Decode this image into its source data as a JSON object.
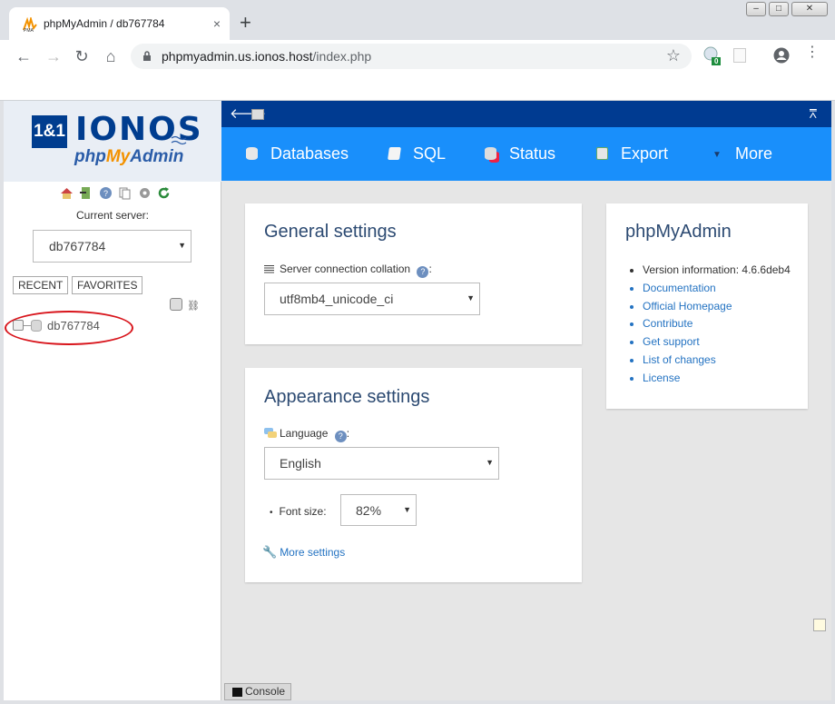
{
  "browser": {
    "tab_title": "phpMyAdmin / db767784",
    "tab_close": "×",
    "new_tab": "+",
    "url_host": "phpmyadmin.us.ionos.host",
    "url_path": "/index.php",
    "extension_badge": "0"
  },
  "sidebar": {
    "logo_11": "1&1",
    "logo_ionos": "IONOS",
    "logo_php": "php",
    "logo_my": "My",
    "logo_admin": "Admin",
    "current_server_label": "Current server:",
    "server_value": "db767784",
    "recent_label": "RECENT",
    "favorites_label": "FAVORITES",
    "tree_db": "db767784"
  },
  "tabs": [
    {
      "label": "Databases",
      "icon": "database-icon"
    },
    {
      "label": "SQL",
      "icon": "sql-icon"
    },
    {
      "label": "Status",
      "icon": "status-icon"
    },
    {
      "label": "Export",
      "icon": "export-icon"
    },
    {
      "label": "More",
      "icon": "chevron-down-icon"
    }
  ],
  "general": {
    "title": "General settings",
    "collation_label": "Server connection collation",
    "collation_value": "utf8mb4_unicode_ci"
  },
  "appearance": {
    "title": "Appearance settings",
    "language_label": "Language",
    "language_value": "English",
    "font_size_label": "Font size:",
    "font_size_value": "82%",
    "more_settings": "More settings"
  },
  "pma": {
    "title": "phpMyAdmin",
    "version": "Version information: 4.6.6deb4",
    "links": [
      "Documentation",
      "Official Homepage",
      "Contribute",
      "Get support",
      "List of changes",
      "License"
    ]
  },
  "console_label": "Console"
}
